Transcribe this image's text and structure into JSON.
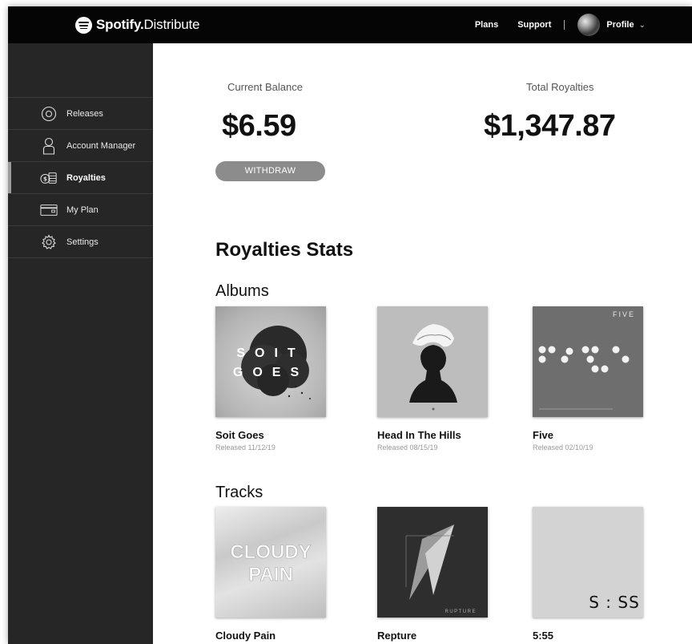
{
  "header": {
    "brand_name": "Spotify.",
    "brand_sub": "Distribute",
    "nav": [
      "Plans",
      "Support"
    ],
    "profile_label": "Profile",
    "chevron": "⌄"
  },
  "sidebar": {
    "items": [
      {
        "label": "Releases",
        "icon": "disc-icon",
        "active": false
      },
      {
        "label": "Account Manager",
        "icon": "user-icon",
        "active": false
      },
      {
        "label": "Royalties",
        "icon": "coins-icon",
        "active": true
      },
      {
        "label": "My Plan",
        "icon": "credit-card-icon",
        "active": false
      },
      {
        "label": "Settings",
        "icon": "gear-icon",
        "active": false
      }
    ]
  },
  "balance": {
    "current_label": "Current Balance",
    "current_value": "$6.59",
    "total_label": "Total Royalties",
    "total_value": "$1,347.87",
    "withdraw_label": "WITHDRAW"
  },
  "stats": {
    "title": "Royalties Stats",
    "albums_title": "Albums",
    "albums": [
      {
        "title": "Soit Goes",
        "date": "Released 11/12/19",
        "cover_text": "S O I T\nG O E S"
      },
      {
        "title": "Head In The Hills",
        "date": "Released 08/15/19"
      },
      {
        "title": "Five",
        "date": "Released 02/10/19",
        "cover_text": "FIVE"
      }
    ],
    "tracks_title": "Tracks",
    "tracks": [
      {
        "title": "Cloudy Pain",
        "cover_text": "CLOUDY PAIN"
      },
      {
        "title": "Repture",
        "cover_text": "RUPTURE"
      },
      {
        "title": "5:55",
        "cover_text": "S : SS"
      }
    ]
  }
}
